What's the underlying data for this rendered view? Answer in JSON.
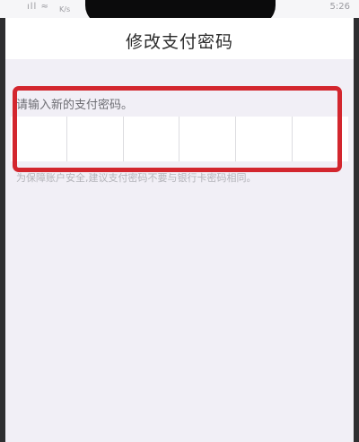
{
  "status_bar": {
    "left": "ıll ≈",
    "speed": "K/s",
    "time": "5:26"
  },
  "header": {
    "title": "修改支付密码"
  },
  "form": {
    "prompt": "请输入新的支付密码。",
    "pin_cells": [
      "",
      "",
      "",
      "",
      "",
      ""
    ],
    "hint": "为保障账户安全,建议支付密码不要与银行卡密码相同。"
  },
  "colors": {
    "highlight": "#d3262e",
    "background": "#f1eff6",
    "header_bg": "#ffffff"
  }
}
